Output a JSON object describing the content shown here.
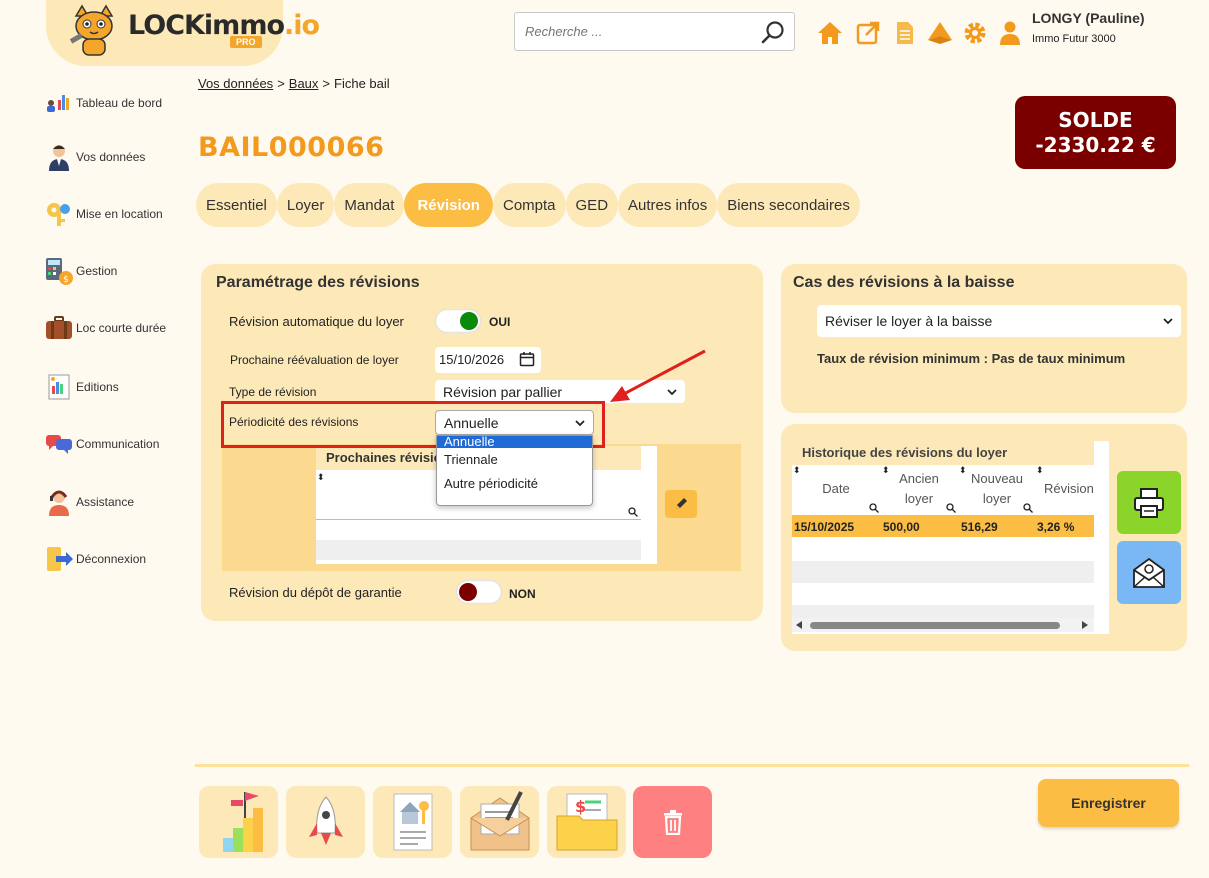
{
  "header": {
    "logo_main": "LOCKimmo",
    "logo_suffix": ".io",
    "logo_badge": "PRO",
    "search_placeholder": "Recherche ...",
    "user_name": "LONGY (Pauline)",
    "user_org": "Immo Futur 3000",
    "icons": [
      "home-icon",
      "external-link-icon",
      "document-icon",
      "alert-icon",
      "gear-icon",
      "user-icon"
    ],
    "accent_color": "#f39a1e"
  },
  "sidebar": {
    "items": [
      {
        "label": "Tableau de bord",
        "icon": "dashboard-icon"
      },
      {
        "label": "Vos données",
        "icon": "person-icon"
      },
      {
        "label": "Mise en location",
        "icon": "keys-icon"
      },
      {
        "label": "Gestion",
        "icon": "calculator-icon"
      },
      {
        "label": "Loc courte durée",
        "icon": "suitcase-icon"
      },
      {
        "label": "Editions",
        "icon": "editions-icon"
      },
      {
        "label": "Communication",
        "icon": "chat-icon"
      },
      {
        "label": "Assistance",
        "icon": "support-icon"
      },
      {
        "label": "Déconnexion",
        "icon": "logout-icon"
      }
    ]
  },
  "breadcrumb": {
    "items": [
      "Vos données",
      "Baux",
      "Fiche bail"
    ],
    "separator": ">"
  },
  "page_title": "BAIL000066",
  "solde": {
    "label": "SOLDE",
    "value": "-2330.22 €",
    "color": "#7a0000"
  },
  "tabs": [
    {
      "label": "Essentiel"
    },
    {
      "label": "Loyer"
    },
    {
      "label": "Mandat"
    },
    {
      "label": "Révision",
      "active": true
    },
    {
      "label": "Compta"
    },
    {
      "label": "GED"
    },
    {
      "label": "Autres infos"
    },
    {
      "label": "Biens secondaires"
    }
  ],
  "params": {
    "title": "Paramétrage des révisions",
    "auto_label": "Révision automatique du loyer",
    "auto_value": "OUI",
    "next_label": "Prochaine réévaluation de loyer",
    "next_value": "15/10/2026",
    "type_label": "Type de révision",
    "type_value": "Révision par pallier",
    "period_label": "Périodicité des révisions",
    "period_value": "Annuelle",
    "period_options": [
      "Annuelle",
      "Triennale",
      "Autre périodicité"
    ],
    "next_table_title": "Prochaines révisions",
    "deposit_label": "Révision du dépôt de garantie",
    "deposit_value": "NON"
  },
  "baisse": {
    "title": "Cas des révisions à la baisse",
    "select_value": "Réviser le loyer à la baisse",
    "taux_text": "Taux de révision minimum : Pas de taux minimum"
  },
  "history": {
    "title": "Historique des révisions du loyer",
    "columns": [
      "Date",
      "Ancien loyer",
      "Nouveau loyer",
      "Révision"
    ],
    "rows": [
      {
        "date": "15/10/2025",
        "ancien": "500,00",
        "nouveau": "516,29",
        "revision": "3,26 %"
      }
    ],
    "print_color": "#8bd42a",
    "mail_color": "#79b8f5"
  },
  "bottom": {
    "buttons": [
      "progress-icon",
      "rocket-icon",
      "property-doc-icon",
      "envelope-letter-icon",
      "invoice-folder-icon",
      "trash-icon"
    ],
    "save_label": "Enregistrer",
    "delete_color": "#ff8080"
  }
}
